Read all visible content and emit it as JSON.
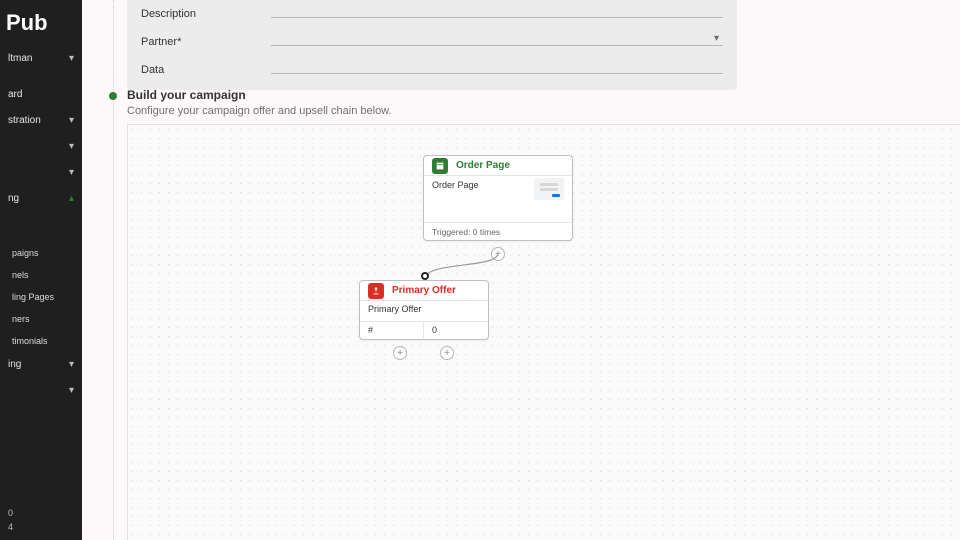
{
  "brand": "Pub",
  "sidebar": {
    "user": "ltman",
    "items": [
      {
        "label": "ard"
      },
      {
        "label": "stration"
      },
      {
        "label": ""
      },
      {
        "label": ""
      },
      {
        "label": "ng",
        "active": true
      }
    ],
    "subitems": [
      {
        "label": "paigns"
      },
      {
        "label": "nels"
      },
      {
        "label": "ling Pages"
      },
      {
        "label": "ners"
      },
      {
        "label": "timonials"
      }
    ],
    "trail": [
      {
        "label": "ing"
      },
      {
        "label": ""
      }
    ],
    "footer": [
      "0",
      "4"
    ]
  },
  "form": {
    "rows": [
      {
        "label": "Description"
      },
      {
        "label": "Partner*",
        "dropdown": true
      },
      {
        "label": "Data"
      }
    ]
  },
  "section": {
    "title": "Build your campaign",
    "subtitle": "Configure your campaign offer and upsell chain below."
  },
  "canvas": {
    "orderPage": {
      "header": "Order Page",
      "body": "Order Page",
      "footer": "Triggered: 0 times"
    },
    "primaryOffer": {
      "header": "Primary Offer",
      "body": "Primary Offer",
      "hash": "#",
      "count": "0"
    },
    "plus": "+"
  }
}
